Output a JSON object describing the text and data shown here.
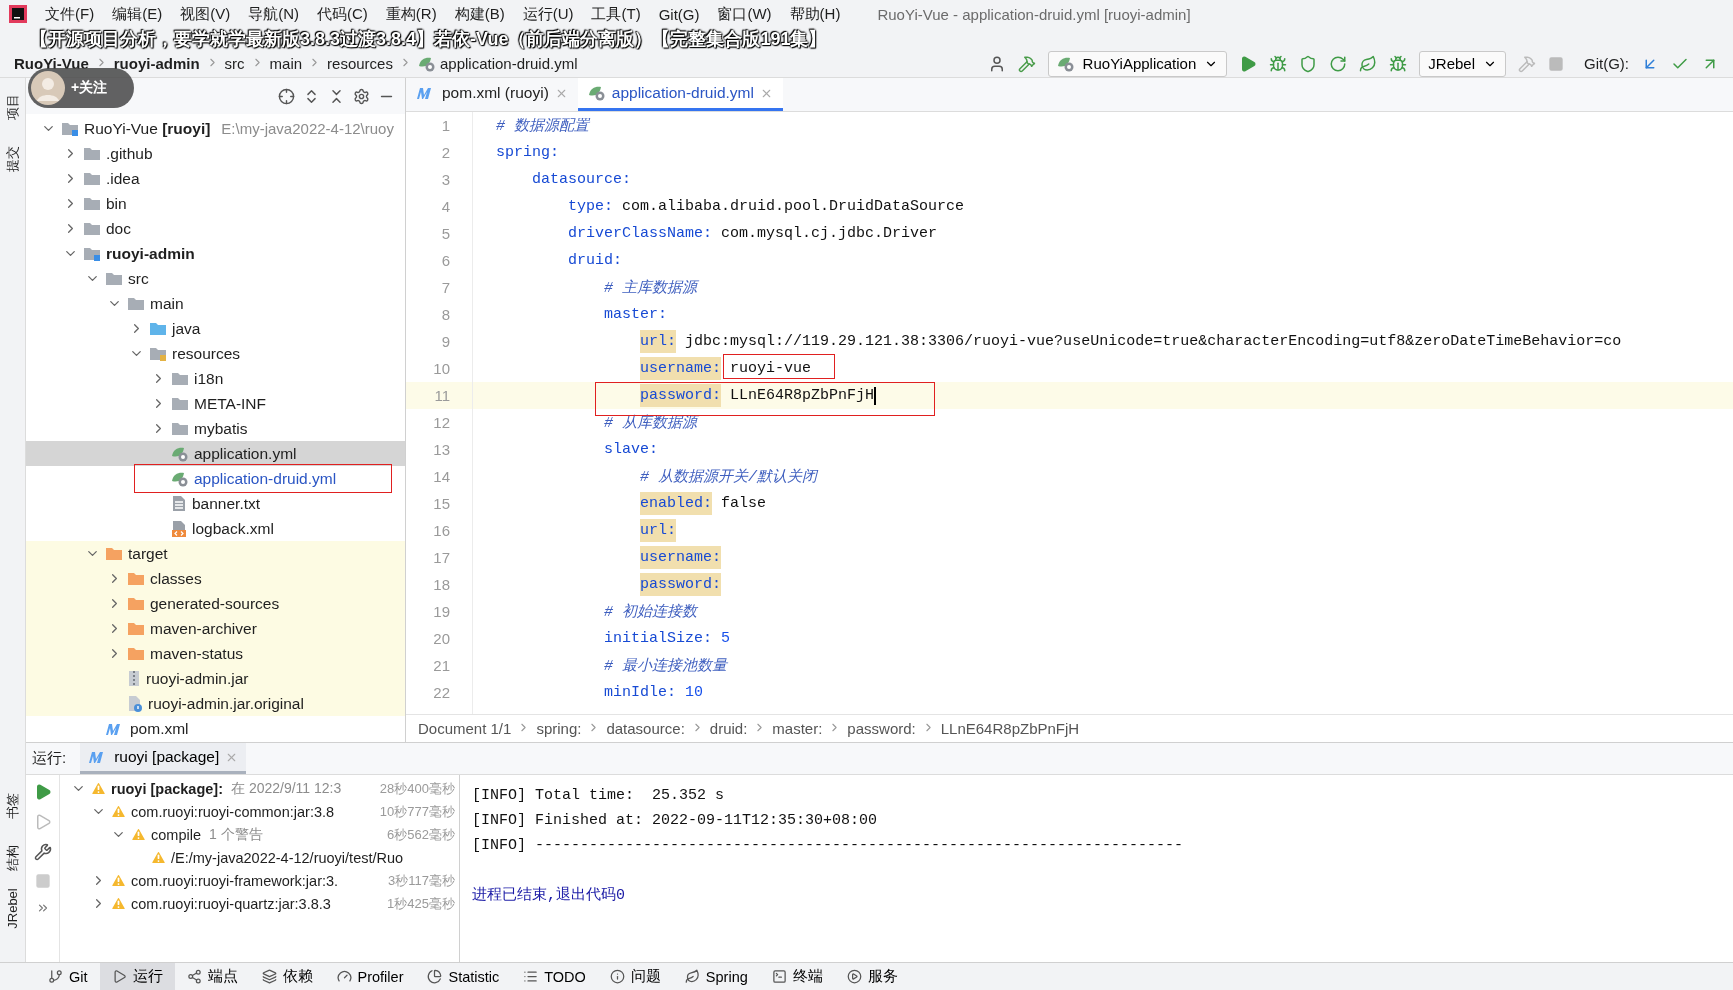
{
  "menu_bar": {
    "items": [
      "文件(F)",
      "编辑(E)",
      "视图(V)",
      "导航(N)",
      "代码(C)",
      "重构(R)",
      "构建(B)",
      "运行(U)",
      "工具(T)",
      "Git(G)",
      "窗口(W)",
      "帮助(H)"
    ],
    "title": "RuoYi-Vue - application-druid.yml [ruoyi-admin]"
  },
  "video_title": "【开源项目分析，要学就学最新版3.8.3过渡3.8.4】若依-Vue（前后端分离版）【完整集合版191集】",
  "follow_badge": "+关注",
  "navigation_bar": {
    "breadcrumbs": [
      {
        "label": "RuoYi-Vue",
        "kind": "project"
      },
      {
        "label": "ruoyi-admin",
        "kind": "module"
      },
      {
        "label": "src",
        "kind": "folder"
      },
      {
        "label": "main",
        "kind": "folder"
      },
      {
        "label": "resources",
        "kind": "folder"
      },
      {
        "label": "application-druid.yml",
        "kind": "file"
      }
    ],
    "run_configuration": "RuoYiApplication",
    "plugin_selector": "JRebel",
    "git_label": "Git(G):"
  },
  "left_strip": {
    "top": [
      "项目",
      "提交"
    ],
    "bottom": [
      "书签",
      "结构",
      "JRebel"
    ]
  },
  "project_tree": [
    {
      "label": "RuoYi-Vue **[ruoyi]**",
      "path": "E:\\my-java2022-4-12\\ruoy",
      "kind": "project",
      "expanded": true,
      "selected": false,
      "children": [
        {
          "label": ".github",
          "kind": "folder",
          "expanded": false,
          "selected": false
        },
        {
          "label": ".idea",
          "kind": "folder",
          "expanded": false,
          "selected": false
        },
        {
          "label": "bin",
          "kind": "folder",
          "expanded": false,
          "selected": false
        },
        {
          "label": "doc",
          "kind": "folder",
          "expanded": false,
          "selected": false
        },
        {
          "label": "ruoyi-admin",
          "kind": "module",
          "expanded": true,
          "selected": false,
          "children": [
            {
              "label": "src",
              "kind": "folder",
              "expanded": true,
              "selected": false,
              "children": [
                {
                  "label": "main",
                  "kind": "folder",
                  "expanded": true,
                  "selected": false,
                  "children": [
                    {
                      "label": "java",
                      "kind": "source",
                      "expanded": false,
                      "selected": false
                    },
                    {
                      "label": "resources",
                      "kind": "resources",
                      "expanded": true,
                      "selected": false,
                      "children": [
                        {
                          "label": "i18n",
                          "kind": "folder",
                          "expanded": false,
                          "selected": false
                        },
                        {
                          "label": "META-INF",
                          "kind": "folder",
                          "expanded": false,
                          "selected": false
                        },
                        {
                          "label": "mybatis",
                          "kind": "folder",
                          "expanded": false,
                          "selected": false
                        },
                        {
                          "label": "application.yml",
                          "kind": "yml",
                          "selected": true
                        },
                        {
                          "label": "application-druid.yml",
                          "kind": "yml",
                          "selected": false,
                          "color": "#2a55c4"
                        },
                        {
                          "label": "banner.txt",
                          "kind": "text",
                          "selected": false
                        },
                        {
                          "label": "logback.xml",
                          "kind": "xml",
                          "selected": false
                        }
                      ]
                    }
                  ]
                }
              ]
            },
            {
              "label": "target",
              "kind": "excluded",
              "expanded": true,
              "selected": false,
              "children": [
                {
                  "label": "classes",
                  "kind": "excluded",
                  "expanded": false,
                  "selected": false
                },
                {
                  "label": "generated-sources",
                  "kind": "excluded",
                  "expanded": false,
                  "selected": false
                },
                {
                  "label": "maven-archiver",
                  "kind": "excluded",
                  "expanded": false,
                  "selected": false
                },
                {
                  "label": "maven-status",
                  "kind": "excluded",
                  "expanded": false,
                  "selected": false
                },
                {
                  "label": "ruoyi-admin.jar",
                  "kind": "jar",
                  "selected": false
                },
                {
                  "label": "ruoyi-admin.jar.original",
                  "kind": "unknown",
                  "selected": false
                }
              ]
            },
            {
              "label": "pom.xml",
              "kind": "maven",
              "selected": false
            }
          ]
        }
      ]
    }
  ],
  "editor": {
    "tabs": [
      {
        "label": "pom.xml (ruoyi)",
        "kind": "maven",
        "selected": false
      },
      {
        "label": "application-druid.yml",
        "kind": "yml",
        "selected": true
      }
    ],
    "lines": [
      {
        "number": "1",
        "kind": "comment",
        "text": "# 数据源配置",
        "current": false
      },
      {
        "number": "2",
        "kind": "pair",
        "key": "spring:",
        "highlighted": false,
        "current": false
      },
      {
        "number": "3",
        "kind": "pair",
        "key": "    datasource:",
        "highlighted": false,
        "current": false
      },
      {
        "number": "4",
        "kind": "pair",
        "key": "        type:",
        "value": "com.alibaba.druid.pool.DruidDataSource",
        "highlighted": false,
        "current": false
      },
      {
        "number": "5",
        "kind": "pair",
        "key": "        driverClassName:",
        "value": "com.mysql.cj.jdbc.Driver",
        "highlighted": false,
        "current": false
      },
      {
        "number": "6",
        "kind": "pair",
        "key": "        druid:",
        "highlighted": false,
        "current": false
      },
      {
        "number": "7",
        "kind": "comment",
        "text": "            # 主库数据源",
        "current": false
      },
      {
        "number": "8",
        "kind": "pair",
        "key": "            master:",
        "highlighted": false,
        "current": false
      },
      {
        "number": "9",
        "kind": "pair",
        "key": "                url:",
        "value": "jdbc:mysql://119.29.121.38:3306/ruoyi-vue?useUnicode=true&characterEncoding=utf8&zeroDateTimeBehavior=co",
        "highlighted": true,
        "current": false
      },
      {
        "number": "10",
        "kind": "pair",
        "key": "                username:",
        "value": "ruoyi-vue",
        "highlighted": true,
        "current": false
      },
      {
        "number": "11",
        "kind": "pair",
        "key": "                password:",
        "value": "LLnE64R8pZbPnFjH",
        "highlighted": true,
        "current": true
      },
      {
        "number": "12",
        "kind": "comment",
        "text": "            # 从库数据源",
        "current": false
      },
      {
        "number": "13",
        "kind": "pair",
        "key": "            slave:",
        "highlighted": false,
        "current": false
      },
      {
        "number": "14",
        "kind": "comment",
        "text": "                # 从数据源开关/默认关闭",
        "current": false
      },
      {
        "number": "15",
        "kind": "pair",
        "key": "                enabled:",
        "value": "false",
        "highlighted": true,
        "current": false
      },
      {
        "number": "16",
        "kind": "pair",
        "key": "                url:",
        "highlighted": true,
        "current": false
      },
      {
        "number": "17",
        "kind": "pair",
        "key": "                username:",
        "highlighted": true,
        "current": false
      },
      {
        "number": "18",
        "kind": "pair",
        "key": "                password:",
        "highlighted": true,
        "current": false
      },
      {
        "number": "19",
        "kind": "comment",
        "text": "            # 初始连接数",
        "current": false
      },
      {
        "number": "20",
        "kind": "number",
        "key": "            initialSize:",
        "value": "5",
        "highlighted": false,
        "current": false
      },
      {
        "number": "21",
        "kind": "comment",
        "text": "            # 最小连接池数量",
        "current": false
      },
      {
        "number": "22",
        "kind": "number",
        "key": "            minIdle:",
        "value": "10",
        "highlighted": false,
        "current": false
      }
    ],
    "breadcrumbs": [
      "Document 1/1",
      "spring:",
      "datasource:",
      "druid:",
      "master:",
      "password:",
      "LLnE64R8pZbPnFjH"
    ]
  },
  "run_panel": {
    "label": "运行:",
    "tab": "ruoyi [package]",
    "tree": [
      {
        "label": "ruoyi [package]:",
        "detail": "在 2022/9/11 12:3",
        "time": "28秒400毫秒",
        "kind": "root",
        "expanded": true,
        "children": [
          {
            "label": "com.ruoyi:ruoyi-common:jar:3.8",
            "time": "10秒777毫秒",
            "kind": "item",
            "expanded": true,
            "children": [
              {
                "label": "compile",
                "detail": "1 个警告",
                "time": "6秒562毫秒",
                "kind": "item",
                "expanded": true,
                "children": [
                  {
                    "label": "/E:/my-java2022-4-12/ruoyi/test/Ruo",
                    "kind": "item"
                  }
                ]
              }
            ]
          },
          {
            "label": "com.ruoyi:ruoyi-framework:jar:3.",
            "time": "3秒117毫秒",
            "kind": "item",
            "expanded": false
          },
          {
            "label": "com.ruoyi:ruoyi-quartz:jar:3.8.3",
            "time": "1秒425毫秒",
            "kind": "item",
            "expanded": false
          }
        ]
      }
    ],
    "console": [
      {
        "text": "[INFO] Total time:  25.352 s",
        "kind": "output"
      },
      {
        "text": "[INFO] Finished at: 2022-09-11T12:35:30+08:00",
        "kind": "output"
      },
      {
        "text": "[INFO] ------------------------------------------------------------------------",
        "kind": "output"
      },
      {
        "text": "进程已结束,退出代码0",
        "kind": "exit"
      }
    ]
  },
  "tool_windows": [
    {
      "label": "Git",
      "kind": "git",
      "selected": false
    },
    {
      "label": "运行",
      "kind": "run",
      "selected": true
    },
    {
      "label": "端点",
      "kind": "endpoints",
      "selected": false
    },
    {
      "label": "依赖",
      "kind": "layers",
      "selected": false
    },
    {
      "label": "Profiler",
      "kind": "profiler",
      "selected": false
    },
    {
      "label": "Statistic",
      "kind": "pie",
      "selected": false
    },
    {
      "label": "TODO",
      "kind": "list",
      "selected": false
    },
    {
      "label": "问题",
      "kind": "info",
      "selected": false
    },
    {
      "label": "Spring",
      "kind": "leaf",
      "selected": false
    },
    {
      "label": "终端",
      "kind": "terminal",
      "selected": false
    },
    {
      "label": "服务",
      "kind": "services",
      "selected": false
    }
  ]
}
